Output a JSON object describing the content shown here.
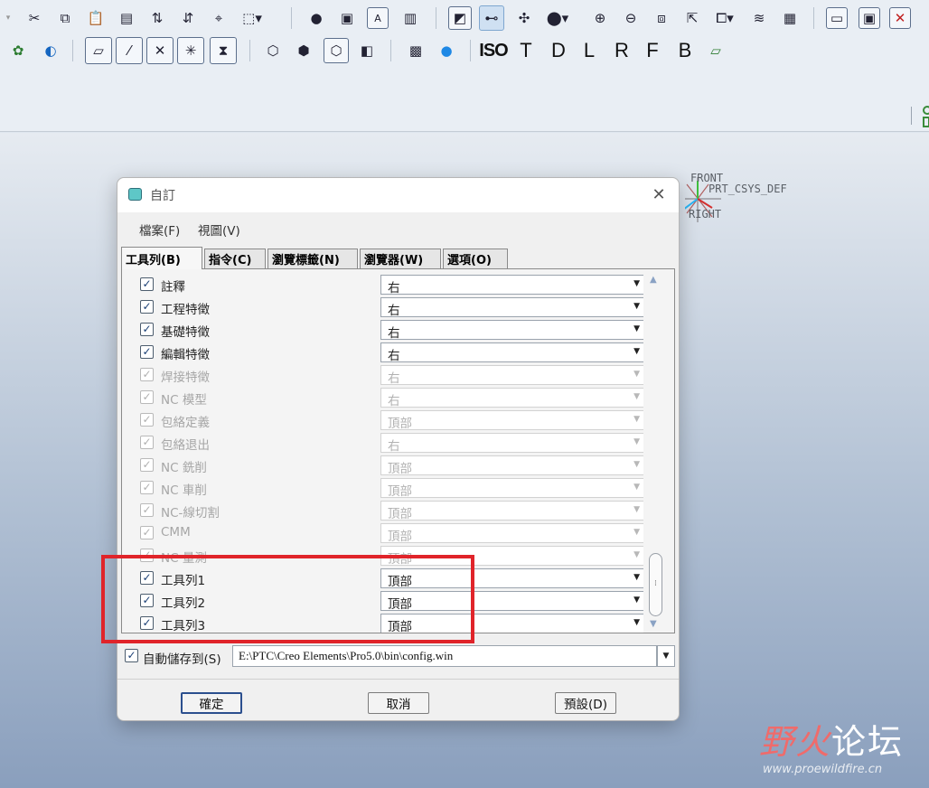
{
  "toolbar": {
    "row2_letters": [
      "ISO",
      "T",
      "D",
      "L",
      "R",
      "F",
      "B"
    ]
  },
  "workspace": {
    "csys_label_1": "FRONT",
    "csys_label_2": "PRT_CSYS_DEF",
    "csys_label_3": "RIGHT"
  },
  "watermark": {
    "title_a": "野火",
    "title_b": "论坛",
    "url": "www.proewildfire.cn"
  },
  "dialog": {
    "title": "自訂",
    "menu": [
      "檔案(F)",
      "視圖(V)"
    ],
    "tabs": [
      "工具列(B)",
      "指令(C)",
      "瀏覽標籤(N)",
      "瀏覽器(W)",
      "選項(O)"
    ],
    "rows": [
      {
        "label": "註釋",
        "value": "右",
        "checked": true,
        "enabled": true
      },
      {
        "label": "工程特徵",
        "value": "右",
        "checked": true,
        "enabled": true
      },
      {
        "label": "基礎特徵",
        "value": "右",
        "checked": true,
        "enabled": true
      },
      {
        "label": "編輯特徵",
        "value": "右",
        "checked": true,
        "enabled": true
      },
      {
        "label": "焊接特徵",
        "value": "右",
        "checked": true,
        "enabled": false
      },
      {
        "label": "NC 模型",
        "value": "右",
        "checked": true,
        "enabled": false
      },
      {
        "label": "包絡定義",
        "value": "頂部",
        "checked": true,
        "enabled": false
      },
      {
        "label": "包絡退出",
        "value": "右",
        "checked": true,
        "enabled": false
      },
      {
        "label": "NC 銑削",
        "value": "頂部",
        "checked": true,
        "enabled": false
      },
      {
        "label": "NC 車削",
        "value": "頂部",
        "checked": true,
        "enabled": false
      },
      {
        "label": "NC-線切割",
        "value": "頂部",
        "checked": true,
        "enabled": false
      },
      {
        "label": "CMM",
        "value": "頂部",
        "checked": true,
        "enabled": false
      },
      {
        "label": "NC 量測",
        "value": "頂部",
        "checked": true,
        "enabled": false
      },
      {
        "label": "工具列1",
        "value": "頂部",
        "checked": true,
        "enabled": true
      },
      {
        "label": "工具列2",
        "value": "頂部",
        "checked": true,
        "enabled": true
      },
      {
        "label": "工具列3",
        "value": "頂部",
        "checked": true,
        "enabled": true
      }
    ],
    "autosave_label": "自動儲存到(S)",
    "autosave_path": "E:\\PTC\\Creo Elements\\Pro5.0\\bin\\config.win",
    "buttons": {
      "ok": "確定",
      "cancel": "取消",
      "defaults": "預設(D)"
    }
  },
  "colors": {
    "highlight": "#e0242a",
    "accent": "#2b4f8e"
  }
}
